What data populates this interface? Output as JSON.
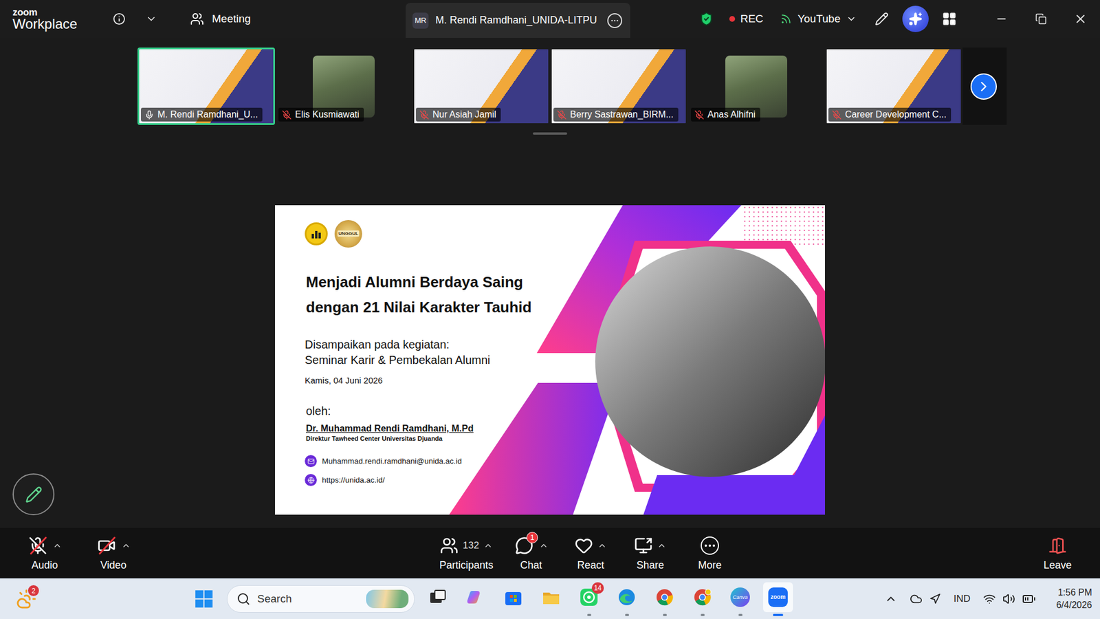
{
  "title_bar": {
    "logo": {
      "top": "zoom",
      "bottom": "Workplace"
    },
    "meeting": "Meeting",
    "tab": {
      "avatar": "MR",
      "title": "M. Rendi Ramdhani_UNIDA-LITPU"
    },
    "recording": "REC",
    "stream": "YouTube"
  },
  "participants": [
    {
      "name": "M. Rendi Ramdhani_U...",
      "kind": "video",
      "muted": false,
      "active": true
    },
    {
      "name": "Elis Kusmiawati",
      "kind": "photo",
      "muted": true,
      "active": false
    },
    {
      "name": "Nur Asiah Jamil",
      "kind": "video",
      "muted": true,
      "active": false
    },
    {
      "name": "Berry Sastrawan_BIRM...",
      "kind": "video",
      "muted": true,
      "active": false
    },
    {
      "name": "Anas Alhifni",
      "kind": "photo",
      "muted": true,
      "active": false
    },
    {
      "name": "Career Development C...",
      "kind": "video",
      "muted": true,
      "active": false
    }
  ],
  "slide": {
    "badge_text": "UNGGUL",
    "title_lines": [
      "Menjadi Alumni Berdaya Saing",
      "dengan 21 Nilai Karakter Tauhid"
    ],
    "event_lines": [
      "Disampaikan pada kegiatan:",
      "Seminar Karir & Pembekalan Alumni"
    ],
    "date": "Kamis, 04 Juni 2026",
    "by_label": "oleh:",
    "speaker": "Dr. Muhammad Rendi Ramdhani, M.Pd",
    "speaker_role": "Direktur Tawheed Center Universitas Djuanda",
    "contacts": [
      {
        "kind": "email",
        "text": "Muhammad.rendi.ramdhani@unida.ac.id"
      },
      {
        "kind": "web",
        "text": "https://unida.ac.id/"
      }
    ]
  },
  "toolbar": [
    {
      "label": "Audio",
      "kind": "audio",
      "off": true,
      "menu": true
    },
    {
      "label": "Video",
      "kind": "video",
      "off": true,
      "menu": true
    },
    {
      "label": "Participants",
      "kind": "participants",
      "count": "132",
      "menu": true
    },
    {
      "label": "Chat",
      "kind": "chat",
      "badge": "1",
      "menu": true
    },
    {
      "label": "React",
      "kind": "react",
      "menu": true
    },
    {
      "label": "Share",
      "kind": "share",
      "menu": true
    },
    {
      "label": "More",
      "kind": "more",
      "menu": false
    },
    {
      "label": "Leave",
      "kind": "leave",
      "menu": false
    }
  ],
  "taskbar": {
    "weather_badge": "2",
    "search_placeholder": "Search",
    "apps": [
      {
        "kind": "task-view",
        "running": false,
        "active": false
      },
      {
        "kind": "copilot",
        "running": false,
        "active": false
      },
      {
        "kind": "store",
        "running": false,
        "active": false
      },
      {
        "kind": "explorer",
        "running": false,
        "active": false
      },
      {
        "kind": "whatsapp",
        "badge": "14",
        "running": true,
        "active": false
      },
      {
        "kind": "edge",
        "running": true,
        "active": false
      },
      {
        "kind": "chrome",
        "running": true,
        "active": false
      },
      {
        "kind": "chrome-profile",
        "running": true,
        "active": false
      },
      {
        "kind": "canva",
        "glyph": "Canva",
        "running": true,
        "active": false
      },
      {
        "kind": "zoom",
        "glyph": "zoom",
        "running": true,
        "active": true
      }
    ],
    "tray": {
      "language": "IND",
      "time": "1:56 PM",
      "date": "6/4/2026"
    }
  }
}
